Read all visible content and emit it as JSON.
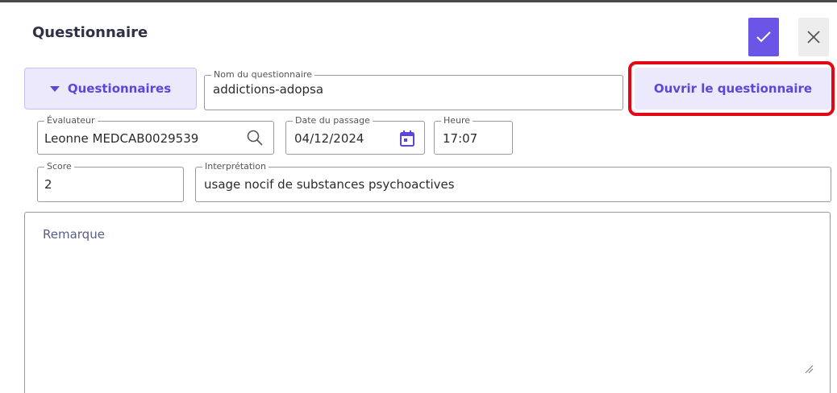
{
  "dialog": {
    "title": "Questionnaire"
  },
  "toolbar": {
    "confirm_icon": "check-icon",
    "close_icon": "close-icon",
    "accent_color": "#6b55e6"
  },
  "questionnaires_button": {
    "label": "Questionnaires",
    "icon": "caret-down-icon"
  },
  "fields": {
    "nom": {
      "label": "Nom du questionnaire",
      "value": "addictions-adopsa"
    },
    "evaluateur": {
      "label": "Évaluateur",
      "value": "Leonne MEDCAB0029539",
      "icon": "search-icon"
    },
    "date": {
      "label": "Date du passage",
      "value": "04/12/2024",
      "icon": "calendar-icon"
    },
    "heure": {
      "label": "Heure",
      "value": "17:07"
    },
    "score": {
      "label": "Score",
      "value": "2"
    },
    "interpretation": {
      "label": "Interprétation",
      "value": "usage nocif de substances psychoactives"
    }
  },
  "open_button": {
    "label": "Ouvrir le questionnaire",
    "highlight_color": "#e30613"
  },
  "remarque": {
    "placeholder": "Remarque"
  }
}
